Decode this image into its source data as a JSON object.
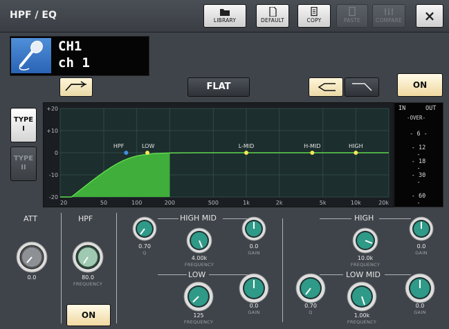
{
  "window": {
    "title": "HPF / EQ"
  },
  "toolbar": {
    "library_label": "LIBRARY",
    "default_label": "DEFAULT",
    "copy_label": "COPY",
    "paste_label": "PASTE",
    "compare_label": "COMPARE",
    "close_glyph": "×"
  },
  "channel": {
    "name": "CH1",
    "label": "ch 1",
    "icon": "microphone-icon"
  },
  "buttons": {
    "flat_label": "FLAT",
    "eq_on_label": "ON",
    "hpf_on_label": "ON",
    "type1_label_a": "TYPE",
    "type1_label_b": "I",
    "type2_label_a": "TYPE",
    "type2_label_b": "II"
  },
  "graph": {
    "y_ticks": [
      "+20",
      "+10",
      "0",
      "-10",
      "-20"
    ],
    "x_ticks": [
      "20",
      "50",
      "100",
      "200",
      "500",
      "1k",
      "2k",
      "5k",
      "10k",
      "20k"
    ],
    "points": [
      {
        "label": "HPF",
        "freq": 80,
        "gain": 0,
        "color": "#3f8fe0"
      },
      {
        "label": "LOW",
        "freq": 125,
        "gain": 0,
        "color": "#f2e85a"
      },
      {
        "label": "L-MID",
        "freq": 1000,
        "gain": 0,
        "color": "#f2e85a"
      },
      {
        "label": "H-MID",
        "freq": 4000,
        "gain": 0,
        "color": "#f2e85a"
      },
      {
        "label": "HIGH",
        "freq": 10000,
        "gain": 0,
        "color": "#f2e85a"
      }
    ]
  },
  "meter": {
    "in_label": "IN",
    "out_label": "OUT",
    "over_label": "-OVER-",
    "scale": [
      "6",
      "12",
      "18",
      "30",
      "60"
    ]
  },
  "att": {
    "title": "ATT",
    "value": "0.0"
  },
  "hpf": {
    "title": "HPF",
    "value": "80.0",
    "sub": "FREQUENCY"
  },
  "high_mid": {
    "title": "HIGH MID",
    "q_value": "0.70",
    "q_sub": "Q",
    "freq_value": "4.00k",
    "freq_sub": "FREQUENCY",
    "gain_value": "0.0",
    "gain_sub": "GAIN"
  },
  "low": {
    "title": "LOW",
    "freq_value": "125",
    "freq_sub": "FREQUENCY",
    "gain_value": "0.0",
    "gain_sub": "GAIN"
  },
  "high": {
    "title": "HIGH",
    "freq_value": "10.0k",
    "freq_sub": "FREQUENCY",
    "gain_value": "0.0",
    "gain_sub": "GAIN"
  },
  "low_mid": {
    "title": "LOW MID",
    "q_value": "0.70",
    "q_sub": "Q",
    "freq_value": "1.00k",
    "freq_sub": "FREQUENCY",
    "gain_value": "0.0",
    "gain_sub": "GAIN"
  }
}
